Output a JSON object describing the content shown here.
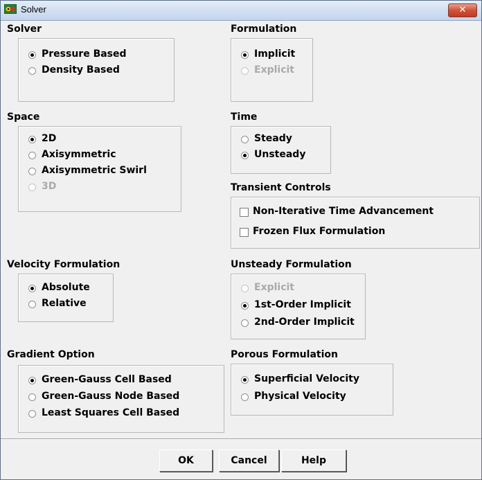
{
  "window": {
    "title": "Solver",
    "close_glyph": "✕"
  },
  "solver": {
    "title": "Solver",
    "options": [
      {
        "label": "Pressure Based",
        "checked": true,
        "disabled": false
      },
      {
        "label": "Density Based",
        "checked": false,
        "disabled": false
      }
    ]
  },
  "formulation": {
    "title": "Formulation",
    "options": [
      {
        "label": "Implicit",
        "checked": true,
        "disabled": false
      },
      {
        "label": "Explicit",
        "checked": false,
        "disabled": true
      }
    ]
  },
  "space": {
    "title": "Space",
    "options": [
      {
        "label": "2D",
        "checked": true,
        "disabled": false
      },
      {
        "label": "Axisymmetric",
        "checked": false,
        "disabled": false
      },
      {
        "label": "Axisymmetric Swirl",
        "checked": false,
        "disabled": false
      },
      {
        "label": "3D",
        "checked": false,
        "disabled": true
      }
    ]
  },
  "time": {
    "title": "Time",
    "options": [
      {
        "label": "Steady",
        "checked": false,
        "disabled": false
      },
      {
        "label": "Unsteady",
        "checked": true,
        "disabled": false
      }
    ]
  },
  "transient_controls": {
    "title": "Transient Controls",
    "options": [
      {
        "label": "Non-Iterative Time Advancement",
        "checked": false
      },
      {
        "label": "Frozen Flux Formulation",
        "checked": false
      }
    ]
  },
  "velocity_formulation": {
    "title": "Velocity Formulation",
    "options": [
      {
        "label": "Absolute",
        "checked": true,
        "disabled": false
      },
      {
        "label": "Relative",
        "checked": false,
        "disabled": false
      }
    ]
  },
  "unsteady_formulation": {
    "title": "Unsteady Formulation",
    "options": [
      {
        "label": "Explicit",
        "checked": false,
        "disabled": true
      },
      {
        "label": "1st-Order Implicit",
        "checked": true,
        "disabled": false
      },
      {
        "label": "2nd-Order Implicit",
        "checked": false,
        "disabled": false
      }
    ]
  },
  "gradient_option": {
    "title": "Gradient Option",
    "options": [
      {
        "label": "Green-Gauss Cell Based",
        "checked": true,
        "disabled": false
      },
      {
        "label": "Green-Gauss Node Based",
        "checked": false,
        "disabled": false
      },
      {
        "label": "Least Squares Cell Based",
        "checked": false,
        "disabled": false
      }
    ]
  },
  "porous_formulation": {
    "title": "Porous Formulation",
    "options": [
      {
        "label": "Superficial Velocity",
        "checked": true,
        "disabled": false
      },
      {
        "label": "Physical Velocity",
        "checked": false,
        "disabled": false
      }
    ]
  },
  "buttons": {
    "ok": "OK",
    "cancel": "Cancel",
    "help": "Help"
  }
}
